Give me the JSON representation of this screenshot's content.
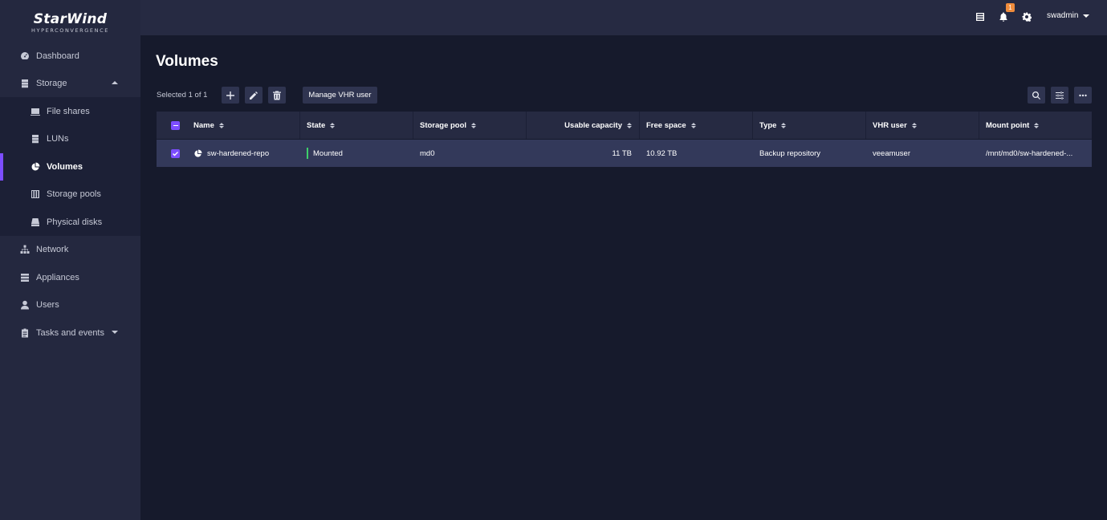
{
  "app": {
    "logo_main": "StarWind",
    "logo_sub": "HYPERCONVERGENCE"
  },
  "sidebar": {
    "items": [
      {
        "label": "Dashboard",
        "icon": "dashboard-icon"
      },
      {
        "label": "Storage",
        "icon": "storage-icon"
      },
      {
        "label": "File shares",
        "icon": "file-shares-icon"
      },
      {
        "label": "LUNs",
        "icon": "luns-icon"
      },
      {
        "label": "Volumes",
        "icon": "volumes-icon"
      },
      {
        "label": "Storage pools",
        "icon": "storage-pools-icon"
      },
      {
        "label": "Physical disks",
        "icon": "physical-disks-icon"
      },
      {
        "label": "Network",
        "icon": "network-icon"
      },
      {
        "label": "Appliances",
        "icon": "appliances-icon"
      },
      {
        "label": "Users",
        "icon": "users-icon"
      },
      {
        "label": "Tasks and events",
        "icon": "tasks-icon"
      }
    ],
    "active": "Volumes"
  },
  "topbar": {
    "notification_count": "1",
    "username": "swadmin"
  },
  "page": {
    "title": "Volumes",
    "selected_text": "Selected 1 of 1",
    "manage_vhr_label": "Manage VHR user"
  },
  "table": {
    "columns": [
      "Name",
      "State",
      "Storage pool",
      "Usable capacity",
      "Free space",
      "Type",
      "VHR user",
      "Mount point"
    ],
    "rows": [
      {
        "name": "sw-hardened-repo",
        "state": "Mounted",
        "storage_pool": "md0",
        "usable_capacity": "11 TB",
        "free_space": "10.92 TB",
        "type": "Backup repository",
        "vhr_user": "veeamuser",
        "mount_point": "/mnt/md0/sw-hardened-..."
      }
    ]
  },
  "colors": {
    "accent": "#7c4dff",
    "state_mounted": "#3ecf6a",
    "badge": "#f08c3c"
  }
}
